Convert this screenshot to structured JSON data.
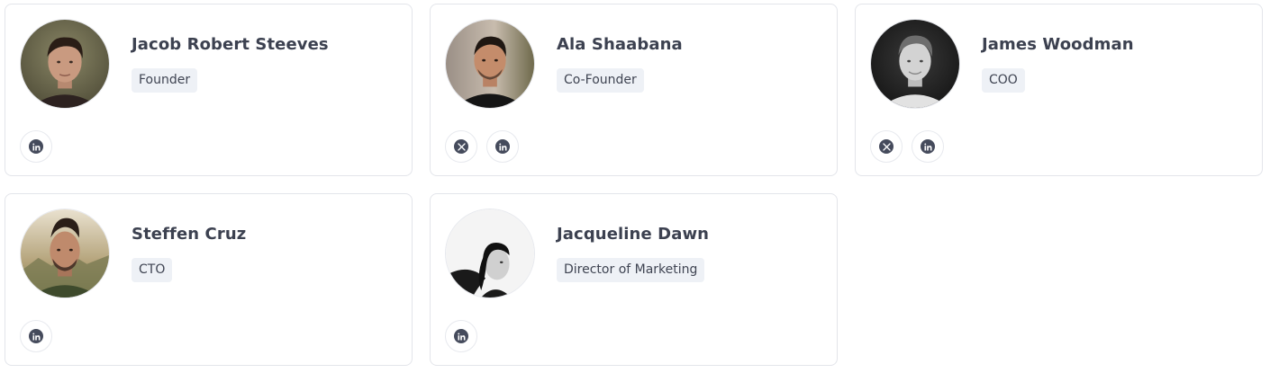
{
  "team": {
    "members": [
      {
        "name": "Jacob Robert Steeves",
        "role": "Founder",
        "avatar": "portrait-photo",
        "socials": [
          "linkedin-icon"
        ]
      },
      {
        "name": "Ala Shaabana",
        "role": "Co-Founder",
        "avatar": "portrait-photo",
        "socials": [
          "x-icon",
          "linkedin-icon"
        ]
      },
      {
        "name": "James Woodman",
        "role": "COO",
        "avatar": "portrait-photo-monochrome",
        "socials": [
          "x-icon",
          "linkedin-icon"
        ]
      },
      {
        "name": "Steffen Cruz",
        "role": "CTO",
        "avatar": "portrait-photo",
        "socials": [
          "linkedin-icon"
        ]
      },
      {
        "name": "Jacqueline Dawn",
        "role": "Director of Marketing",
        "avatar": "portrait-photo-monochrome",
        "socials": [
          "linkedin-icon"
        ]
      }
    ]
  },
  "colors": {
    "card_border": "#e3e5ea",
    "badge_background": "#eef1f6",
    "text": "#3c4150",
    "icon": "#454b5c"
  }
}
